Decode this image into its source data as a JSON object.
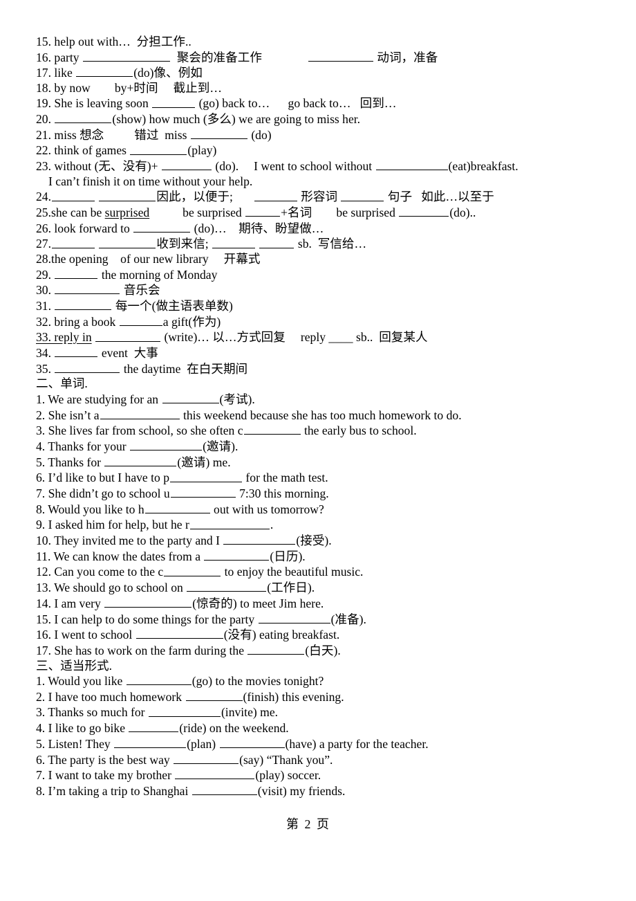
{
  "document": {
    "page_label": "第 2 页",
    "sections": [
      {
        "id": "phrases",
        "heading": null,
        "lines": [
          {
            "id": "p15",
            "num": "15.",
            "text": "help out with…  分担工作.."
          },
          {
            "id": "p16",
            "num": "16.",
            "text": "party",
            "mid": "聚会的准备工作",
            "tail": "动词，准备"
          },
          {
            "id": "p17",
            "num": "17.",
            "text": "like",
            "tail": "(do)像、例如"
          },
          {
            "id": "p18",
            "num": "18.",
            "text": "by now        by+时间     截止到…"
          },
          {
            "id": "p19",
            "num": "19.",
            "text": "She is leaving soon",
            "tail": "(go) back to…      go back to…   回到…"
          },
          {
            "id": "p20",
            "num": "20.",
            "tail": "(show) how much (多么) we are going to miss her."
          },
          {
            "id": "p21",
            "num": "21.",
            "text": "miss 想念          错过  miss",
            "tail": "(do)"
          },
          {
            "id": "p22",
            "num": "22.",
            "text": "think of games",
            "tail": "(play)"
          },
          {
            "id": "p23",
            "num": "23.",
            "text": "without (无、没有)+",
            "mid": "(do).     I went to school without",
            "tail": "(eat)breakfast."
          },
          {
            "id": "p23b",
            "num": "",
            "text": "I can’t finish it on time without your help."
          },
          {
            "id": "p24",
            "num": "24.",
            "mid": "因此，以便于;",
            "mid2": "形容词",
            "mid3": "句子   如此…以至于"
          },
          {
            "id": "p25",
            "num": "25.",
            "text": "she can be ",
            "underlined": "surprised",
            "mid": "be surprised",
            "mid2": "+名词        be surprised",
            "tail": "(do).."
          },
          {
            "id": "p26",
            "num": "26.",
            "text": "look forward to",
            "tail": "(do)…    期待、盼望做…"
          },
          {
            "id": "p27",
            "num": "27.",
            "mid": "收到来信;",
            "tail": "sb.  写信给…"
          },
          {
            "id": "p28",
            "num": "28.",
            "text": "the opening    of our new library     开幕式"
          },
          {
            "id": "p29",
            "num": "29.",
            "tail": "the morning of Monday"
          },
          {
            "id": "p30",
            "num": "30.",
            "tail": "音乐会"
          },
          {
            "id": "p31",
            "num": "31.",
            "tail": "每一个(做主语表单数)"
          },
          {
            "id": "p32",
            "num": "32.",
            "text": "bring a book",
            "tail": "a gift(作为)"
          },
          {
            "id": "p33",
            "num": "33.",
            "underlined": "33. reply in",
            "tail": "(write)… 以…方式回复     reply ____ sb..  回复某人"
          },
          {
            "id": "p34",
            "num": "34.",
            "tail": "event  大事"
          },
          {
            "id": "p35",
            "num": "35.",
            "tail": "the daytime  在白天期间"
          }
        ]
      },
      {
        "id": "vocabulary",
        "heading": "二、单词.",
        "lines": [
          {
            "id": "v1",
            "num": "1.",
            "pre": "We are studying for an",
            "post": "(考试)."
          },
          {
            "id": "v2",
            "num": "2.",
            "pre": "She isn’t a",
            "post": "this weekend because she has too much homework to do."
          },
          {
            "id": "v3",
            "num": "3.",
            "pre": "She lives far from school, so she often c",
            "post": "the early bus to school."
          },
          {
            "id": "v4",
            "num": "4.",
            "pre": "Thanks for your",
            "post": "(邀请)."
          },
          {
            "id": "v5",
            "num": "5.",
            "pre": "Thanks for",
            "post": "(邀请) me."
          },
          {
            "id": "v6",
            "num": "6.",
            "pre": "I’d like to but I have to p",
            "post": "for the math test."
          },
          {
            "id": "v7",
            "num": "7.",
            "pre": "She didn’t go to school u",
            "post": "7:30 this morning."
          },
          {
            "id": "v8",
            "num": "8.",
            "pre": "Would you like to h",
            "post": "out with us tomorrow?"
          },
          {
            "id": "v9",
            "num": "9.",
            "pre": "I asked him for help, but he r",
            "post": "."
          },
          {
            "id": "v10",
            "num": "10.",
            "pre": "They invited me to the party and I",
            "post": "(接受)."
          },
          {
            "id": "v11",
            "num": "11.",
            "pre": "We can know the dates from a",
            "post": "(日历)."
          },
          {
            "id": "v12",
            "num": "12.",
            "pre": "Can you come to the c",
            "post": "to enjoy the beautiful music."
          },
          {
            "id": "v13",
            "num": "13.",
            "pre": "We should go to school on",
            "post": "(工作日)."
          },
          {
            "id": "v14",
            "num": "14.",
            "pre": "I am very",
            "post": "(惊奇的) to meet Jim here."
          },
          {
            "id": "v15",
            "num": "15.",
            "pre": "I can help to do some things for the party",
            "post": "(准备)."
          },
          {
            "id": "v16",
            "num": "16.",
            "pre": "I went to school",
            "post": "(没有) eating breakfast."
          },
          {
            "id": "v17",
            "num": "17.",
            "pre": "She has to work on the farm during the",
            "post": "(白天)."
          }
        ]
      },
      {
        "id": "forms",
        "heading": "三、适当形式.",
        "lines": [
          {
            "id": "f1",
            "num": "1.",
            "pre": "Would you like",
            "post": "(go) to the movies tonight?"
          },
          {
            "id": "f2",
            "num": "2.",
            "pre": "I have too much homework",
            "post": "(finish) this evening."
          },
          {
            "id": "f3",
            "num": "3.",
            "pre": "Thanks so much for",
            "post": "(invite) me."
          },
          {
            "id": "f4",
            "num": "4.",
            "pre": "I like to go bike",
            "post": "(ride) on the weekend."
          },
          {
            "id": "f5",
            "num": "5.",
            "pre": "Listen! They",
            "mid": "(plan)",
            "post": "(have) a party for the teacher."
          },
          {
            "id": "f6",
            "num": "6.",
            "pre": "The party is the best way",
            "post": "(say) “Thank you”."
          },
          {
            "id": "f7",
            "num": "7.",
            "pre": "I want to take my brother",
            "post": "(play) soccer."
          },
          {
            "id": "f8",
            "num": "8.",
            "pre": "I’m taking a trip to Shanghai",
            "post": "(visit) my friends."
          }
        ]
      }
    ]
  }
}
